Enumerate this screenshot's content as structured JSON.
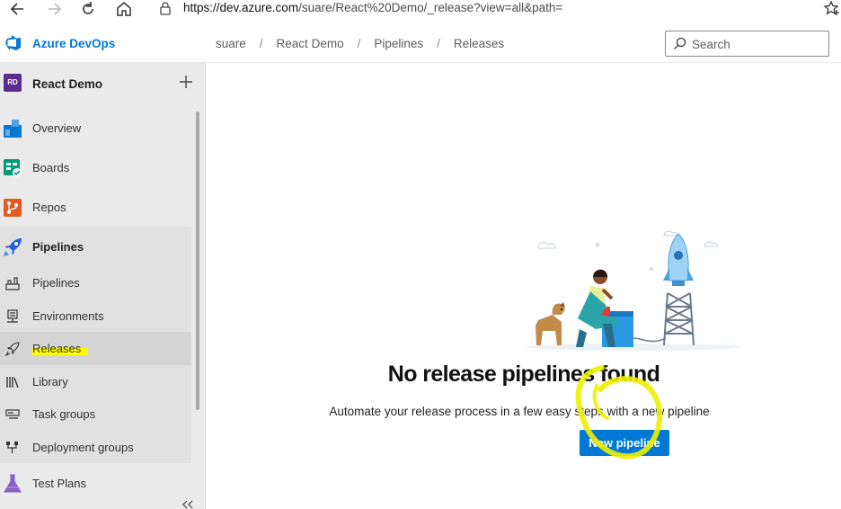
{
  "browser": {
    "url_host": "https://dev.azure.com",
    "url_path": "/suare/React%20Demo/_release?view=all&path="
  },
  "header": {
    "brand": "Azure DevOps",
    "breadcrumb": [
      "suare",
      "React Demo",
      "Pipelines",
      "Releases"
    ],
    "search_placeholder": "Search"
  },
  "sidebar": {
    "project_initials": "RD",
    "project_name": "React Demo",
    "items": [
      {
        "label": "Overview",
        "icon": "overview-icon"
      },
      {
        "label": "Boards",
        "icon": "boards-icon"
      },
      {
        "label": "Repos",
        "icon": "repos-icon"
      },
      {
        "label": "Pipelines",
        "icon": "pipelines-icon"
      }
    ],
    "pipelines_sub": [
      {
        "label": "Pipelines",
        "icon": "pipeline-build-icon"
      },
      {
        "label": "Environments",
        "icon": "environments-icon"
      },
      {
        "label": "Releases",
        "icon": "rocket-icon",
        "selected": true
      },
      {
        "label": "Library",
        "icon": "library-icon"
      },
      {
        "label": "Task groups",
        "icon": "task-groups-icon"
      },
      {
        "label": "Deployment groups",
        "icon": "deployment-groups-icon"
      }
    ],
    "test_plans": {
      "label": "Test Plans",
      "icon": "flask-icon"
    }
  },
  "main": {
    "empty_title": "No release pipelines found",
    "empty_description": "Automate your release process in a few easy steps with a new pipeline",
    "cta_label": "New pipeline"
  },
  "colors": {
    "accent": "#0078d4",
    "highlight": "#ffff00",
    "project_avatar": "#5c2d91"
  }
}
